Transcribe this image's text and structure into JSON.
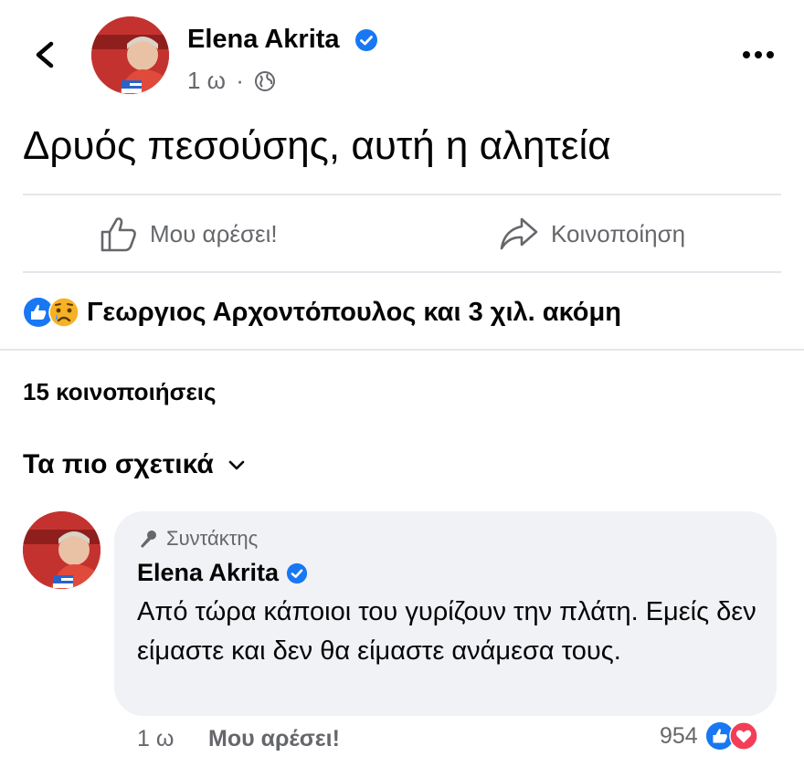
{
  "header": {
    "author": "Elena Akrita",
    "time": "1 ω",
    "separator": "·"
  },
  "post": {
    "text": "Δρυός πεσούσης, αυτή η αλητεία"
  },
  "actions": {
    "like_label": "Μου αρέσει!",
    "share_label": "Κοινοποίηση"
  },
  "reactions": {
    "summary": "Γεωργιος Αρχοντόπουλος και 3 χιλ. ακόμη"
  },
  "shares": {
    "label": "15 κοινοποιήσεις"
  },
  "comments": {
    "sort_label": "Τα πιο σχετικά",
    "items": [
      {
        "badge": "Συντάκτης",
        "author": "Elena Akrita",
        "text": "Από τώρα κάποιοι του γυρίζουν την πλάτη. Εμείς δεν είμαστε και δεν θα είμαστε ανάμεσα τους.",
        "time": "1 ω",
        "like_label": "Μου αρέσει!",
        "reaction_count": "954"
      }
    ]
  },
  "colors": {
    "verified": "#1877f2",
    "like_blue": "#1877f2",
    "love_red": "#f33e58",
    "secondary_text": "#65676b",
    "comment_bg": "#f0f2f5"
  },
  "icons": [
    "back-arrow-icon",
    "verified-badge-icon",
    "globe-icon",
    "more-icon",
    "thumbs-up-icon",
    "share-arrow-icon",
    "like-reaction-icon",
    "sad-reaction-icon",
    "chevron-down-icon",
    "microphone-icon",
    "love-reaction-icon"
  ]
}
